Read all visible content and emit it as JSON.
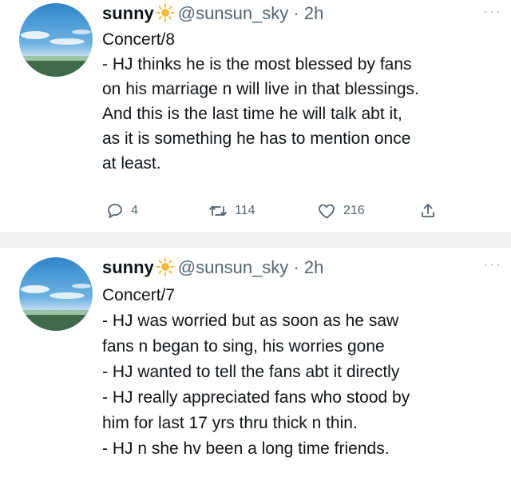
{
  "tweets": [
    {
      "display_name": "sunny",
      "handle_time": "@sunsun_sky · 2h",
      "lines": [
        "Concert/8",
        "- HJ thinks he is the most blessed by fans",
        "on his marriage n will live in that blessings.",
        "And this is the last time he will talk abt it,",
        "as it is something he has to mention once",
        "at least."
      ],
      "replies": "4",
      "retweets": "114",
      "likes": "216"
    },
    {
      "display_name": "sunny",
      "handle_time": "@sunsun_sky · 2h",
      "lines": [
        "Concert/7",
        "- HJ was worried but as soon as he saw",
        "fans n began to sing, his worries gone",
        "- HJ wanted to tell the fans abt it directly",
        "- HJ really appreciated fans who stood by",
        "him for last 17 yrs thru thick n thin.",
        "- HJ n she hv been a long time friends."
      ]
    }
  ],
  "more_label": "···",
  "colors": {
    "text": "#0f1419",
    "secondary": "#536471",
    "divider": "#f2f3f4"
  }
}
